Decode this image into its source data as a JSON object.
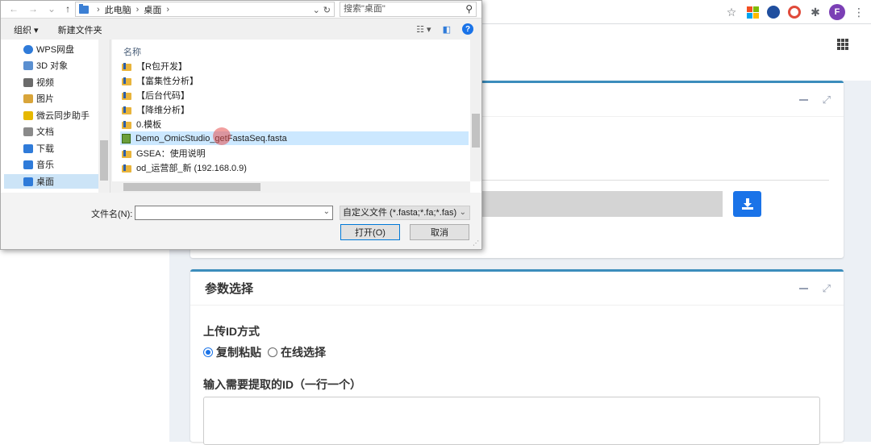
{
  "browser": {
    "profile_initial": "F",
    "ext_ms_colors": [
      "#f25022",
      "#7fba00",
      "#00a4ef",
      "#ffb900"
    ]
  },
  "dialog": {
    "breadcrumb": [
      "此电脑",
      "桌面"
    ],
    "search_placeholder": "搜索\"桌面\"",
    "toolbar": {
      "organize": "组织",
      "new_folder": "新建文件夹"
    },
    "nav_items": [
      {
        "label": "WPS网盘",
        "color": "#2f7bd9"
      },
      {
        "label": "3D 对象",
        "color": "#5a8fd0"
      },
      {
        "label": "视频",
        "color": "#6b6b6b"
      },
      {
        "label": "图片",
        "color": "#d9a53a"
      },
      {
        "label": "微云同步助手",
        "color": "#e6b800"
      },
      {
        "label": "文档",
        "color": "#8a8a8a"
      },
      {
        "label": "下载",
        "color": "#2f7bd9"
      },
      {
        "label": "音乐",
        "color": "#2f7bd9"
      },
      {
        "label": "桌面",
        "color": "#2f7bd9"
      }
    ],
    "column_header": "名称",
    "files": [
      {
        "name": "【R包开发】",
        "type": "folder"
      },
      {
        "name": "【富集性分析】",
        "type": "folder"
      },
      {
        "name": "【后台代码】",
        "type": "folder"
      },
      {
        "name": "【降维分析】",
        "type": "folder"
      },
      {
        "name": "0.模板",
        "type": "folder"
      },
      {
        "name": "Demo_OmicStudio_getFastaSeq.fasta",
        "type": "file"
      },
      {
        "name": "GSEA：使用说明",
        "type": "folder"
      },
      {
        "name": "od_运营部_新 (192.168.0.9)",
        "type": "folder"
      }
    ],
    "filename_label": "文件名(N):",
    "filename_value": "",
    "filter": "自定义文件 (*.fasta;*.fa;*.fas)",
    "open_button": "打开(O)",
    "cancel_button": "取消"
  },
  "page": {
    "section2_title": "参数选择",
    "upload_label": "上传ID方式",
    "radio_options": [
      "复制粘贴",
      "在线选择"
    ],
    "id_label": "输入需要提取的ID（一行一个）"
  }
}
